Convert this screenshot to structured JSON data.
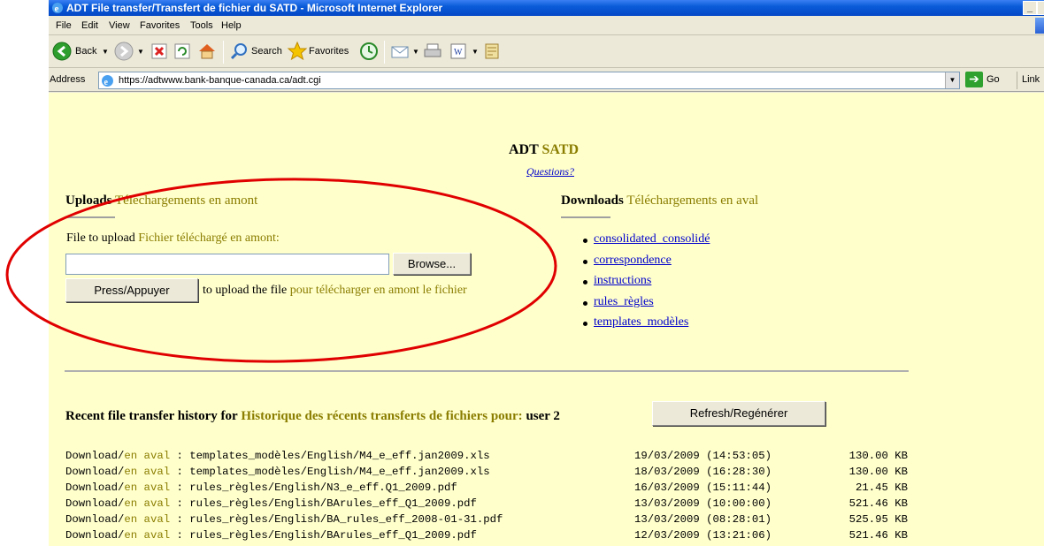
{
  "window": {
    "title": "ADT File transfer/Transfert de fichier du SATD - Microsoft Internet Explorer"
  },
  "menu": [
    "File",
    "Edit",
    "View",
    "Favorites",
    "Tools",
    "Help"
  ],
  "toolbar": {
    "back_label": "Back",
    "search_label": "Search",
    "favorites_label": "Favorites"
  },
  "address": {
    "label": "Address",
    "url": "https://adtwww.bank-banque-canada.ca/adt.cgi",
    "go_label": "Go",
    "links_label": "Link"
  },
  "page": {
    "header_en": "ADT",
    "header_fr": "SATD",
    "questions_link": "Questions?",
    "uploads": {
      "title_en": "Uploads",
      "title_fr": "Téléchargements en amont",
      "file_label_en": "File to upload",
      "file_label_fr": "Fichier téléchargé en amont:",
      "file_value": "",
      "browse_label": "Browse...",
      "press_label": "Press/Appuyer",
      "hint_en": "to upload the file",
      "hint_fr": "pour télécharger en amont le fichier"
    },
    "downloads": {
      "title_en": "Downloads",
      "title_fr": "Téléchargements en aval",
      "items": [
        "consolidated_consolidé",
        "correspondence",
        "instructions",
        "rules_règles",
        "templates_modèles"
      ]
    },
    "recent": {
      "label_en": "Recent file transfer history for",
      "label_fr": "Historique des récents transferts de fichiers pour:",
      "user": "user 2",
      "refresh_label": "Refresh/Regénérer"
    },
    "history": [
      {
        "action_en": "Download/",
        "action_fr": "en aval",
        "path": " : templates_modèles/English/M4_e_eff.jan2009.xls",
        "date": "19/03/2009 (14:53:05)",
        "size": "130.00 KB"
      },
      {
        "action_en": "Download/",
        "action_fr": "en aval",
        "path": " : templates_modèles/English/M4_e_eff.jan2009.xls",
        "date": "18/03/2009 (16:28:30)",
        "size": "130.00 KB"
      },
      {
        "action_en": "Download/",
        "action_fr": "en aval",
        "path": " : rules_règles/English/N3_e_eff.Q1_2009.pdf",
        "date": "16/03/2009 (15:11:44)",
        "size": "21.45 KB"
      },
      {
        "action_en": "Download/",
        "action_fr": "en aval",
        "path": " : rules_règles/English/BArules_eff_Q1_2009.pdf",
        "date": "13/03/2009 (10:00:00)",
        "size": "521.46 KB"
      },
      {
        "action_en": "Download/",
        "action_fr": "en aval",
        "path": " : rules_règles/English/BA_rules_eff_2008-01-31.pdf",
        "date": "13/03/2009 (08:28:01)",
        "size": "525.95 KB"
      },
      {
        "action_en": "Download/",
        "action_fr": "en aval",
        "path": " : rules_règles/English/BArules_eff_Q1_2009.pdf",
        "date": "12/03/2009 (13:21:06)",
        "size": "521.46 KB"
      }
    ]
  },
  "colors": {
    "page_bg": "#ffffcc",
    "french_text": "#8a7d00",
    "link": "#0000cc",
    "annotation": "#e00000",
    "titlebar": "#0a5bd8"
  }
}
